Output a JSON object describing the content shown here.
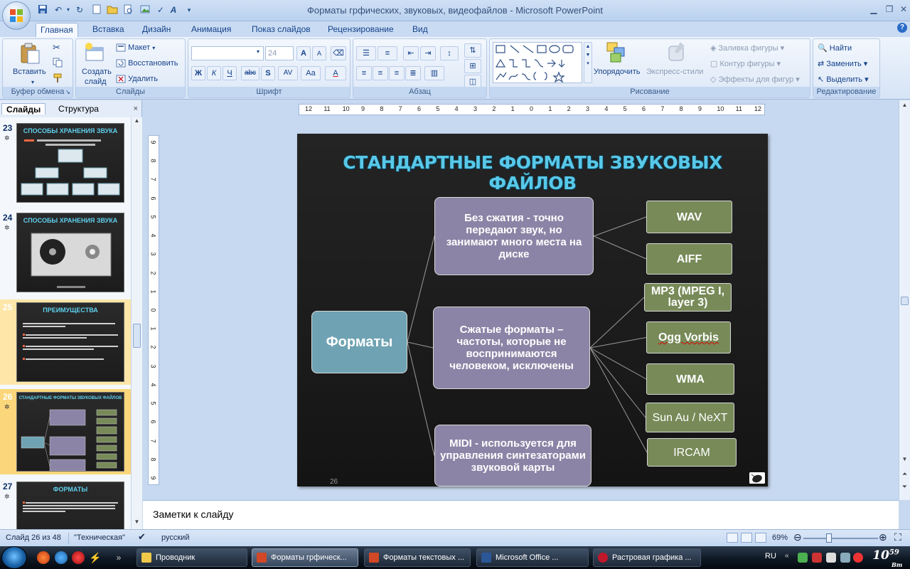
{
  "window": {
    "title_doc": "Форматы грфических, звуковых, видеофайлов",
    "title_sep": " - ",
    "title_app": "Microsoft PowerPoint"
  },
  "ribbon": {
    "tabs": [
      "Главная",
      "Вставка",
      "Дизайн",
      "Анимация",
      "Показ слайдов",
      "Рецензирование",
      "Вид"
    ],
    "active_tab": "Главная",
    "groups": {
      "clipboard": {
        "label": "Буфер обмена",
        "paste": "Вставить"
      },
      "slides": {
        "label": "Слайды",
        "create_line1": "Создать",
        "create_line2": "слайд",
        "layout": "Макет",
        "reset": "Восстановить",
        "delete": "Удалить"
      },
      "font": {
        "label": "Шрифт",
        "font_size": "24",
        "bold": "Ж",
        "italic": "К",
        "underline": "Ч",
        "strike": "abc",
        "shadow": "S",
        "spacing": "AV",
        "case": "Aa",
        "grow": "A",
        "shrink": "A",
        "color": "A"
      },
      "paragraph": {
        "label": "Абзац"
      },
      "drawing": {
        "label": "Рисование",
        "arrange": "Упорядочить",
        "quick_styles": "Экспресс-стили",
        "fill": "Заливка фигуры",
        "outline": "Контур фигуры",
        "effects": "Эффекты для фигур"
      },
      "editing": {
        "label": "Редактирование",
        "find": "Найти",
        "replace": "Заменить",
        "select": "Выделить"
      }
    }
  },
  "left_pane": {
    "tabs": [
      "Слайды",
      "Структура"
    ],
    "close": "×",
    "thumbnails": [
      {
        "number": "23",
        "title": "СПОСОБЫ ХРАНЕНИЯ ЗВУКА"
      },
      {
        "number": "24",
        "title": "СПОСОБЫ ХРАНЕНИЯ ЗВУКА"
      },
      {
        "number": "25",
        "title": "ПРЕИМУЩЕСТВА"
      },
      {
        "number": "26",
        "title": "СТАНДАРТНЫЕ ФОРМАТЫ ЗВУКОВЫХ ФАЙЛОВ"
      },
      {
        "number": "27",
        "title": "ФОРМАТЫ"
      }
    ]
  },
  "ruler": {
    "h_ticks": [
      "12",
      "11",
      "10",
      "9",
      "8",
      "7",
      "6",
      "5",
      "4",
      "3",
      "2",
      "1",
      "0",
      "1",
      "2",
      "3",
      "4",
      "5",
      "6",
      "7",
      "8",
      "9",
      "10",
      "11",
      "12"
    ],
    "v_ticks": [
      "9",
      "8",
      "7",
      "6",
      "5",
      "4",
      "3",
      "2",
      "1",
      "0",
      "1",
      "2",
      "3",
      "4",
      "5",
      "6",
      "7",
      "8",
      "9"
    ]
  },
  "slide": {
    "title": "СТАНДАРТНЫЕ ФОРМАТЫ ЗВУКОВЫХ ФАЙЛОВ",
    "root": "Форматы",
    "branches": [
      {
        "text": "Без сжатия  - точно передают звук, но занимают много места на диске",
        "leaves": [
          "WAV",
          "AIFF"
        ]
      },
      {
        "text": "Сжатые форматы – частоты, которые не воспринимаются человеком, исключены",
        "leaves": [
          "MP3 (MPEG I, layer 3)",
          "Ogg Vorbis",
          "WMA",
          "Sun Au / NeXT",
          "IRCAM"
        ]
      },
      {
        "text": "MIDI - используется для управления синтезаторами звуковой карты",
        "leaves": []
      }
    ],
    "number": "26"
  },
  "notes": {
    "placeholder": "Заметки к слайду"
  },
  "status": {
    "slide_info": "Слайд 26 из 48",
    "theme": "\"Техническая\"",
    "language": "русский",
    "zoom": "69%",
    "zoom_fraction": 0.3
  },
  "taskbar": {
    "tasks": [
      "Проводник",
      "Форматы грфическ...",
      "Форматы текстовых ...",
      "Microsoft Office ...",
      "Растровая графика ..."
    ],
    "lang": "RU",
    "clock_hour": "10",
    "clock_min": "59",
    "clock_sub": "Вт"
  },
  "colors": {
    "slide_bg": "#1e1e1e",
    "title": "#58c8e8",
    "root_box": "#6fa3b3",
    "mid_box": "#8c84a6",
    "leaf_box": "#778a58",
    "selected_thumb": "#fbd67a"
  }
}
